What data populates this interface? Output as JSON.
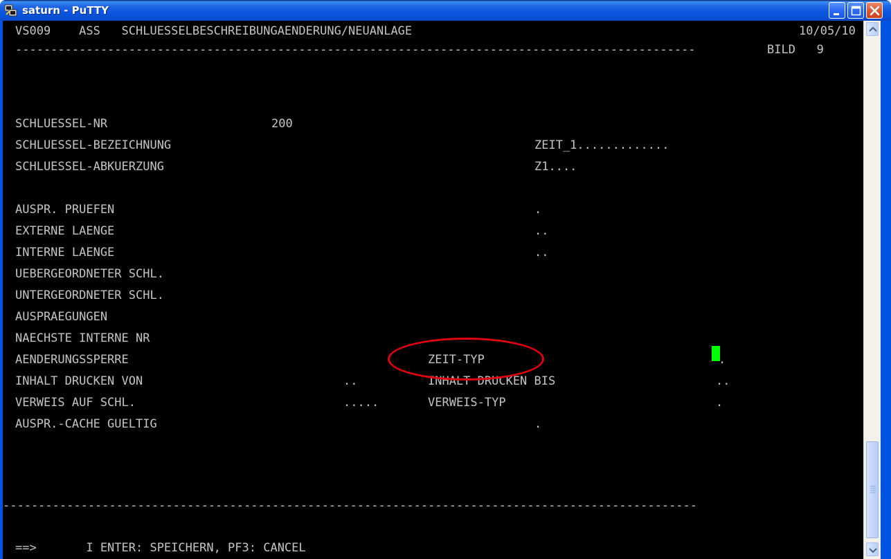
{
  "window": {
    "title": "saturn - PuTTY"
  },
  "terminal": {
    "lines": {
      "header": "VS009    ASS   SCHLUESSELBESCHREIBUNGAENDERUNG/NEUANLAGE",
      "date": "10/05/10",
      "separator1": "------------------------------------------------------------------------------------------------",
      "bild": "BILD   9",
      "schluessel_nr_label": "SCHLUESSEL-NR",
      "schluessel_nr_value": "200",
      "bezeichnung_label": "SCHLUESSEL-BEZEICHNUNG",
      "bezeichnung_value": "ZEIT_1.............",
      "abkuerzung_label": "SCHLUESSEL-ABKUERZUNG",
      "abkuerzung_value": "Z1....",
      "auspr_pruefen_label": "AUSPR. PRUEFEN",
      "auspr_pruefen_value": ".",
      "externe_laenge_label": "EXTERNE LAENGE",
      "externe_laenge_value": "..",
      "interne_laenge_label": "INTERNE LAENGE",
      "interne_laenge_value": "..",
      "uebergeordneter_label": "UEBERGEORDNETER SCHL.",
      "untergeordneter_label": "UNTERGEORDNETER SCHL.",
      "auspraegungen_label": "AUSPRAEGUNGEN",
      "naechste_label": "NAECHSTE INTERNE NR",
      "aenderungssperre_label": "AENDERUNGSSPERRE",
      "zeit_typ_label": "ZEIT-TYP",
      "zeit_typ_value": ".",
      "inhalt_von_label": "INHALT DRUCKEN VON",
      "inhalt_von_value": "..",
      "inhalt_bis_label": "INHALT DRUCKEN BIS",
      "inhalt_bis_value": "..",
      "verweis_label": "VERWEIS AUF SCHL.",
      "verweis_value": ".....",
      "verweis_typ_label": "VERWEIS-TYP",
      "verweis_typ_value": ".",
      "cache_label": "AUSPR.-CACHE GUELTIG",
      "cache_value": ".",
      "separator2": "--------------------------------------------------------------------------------------------------",
      "prompt": "==>       I ENTER: SPEICHERN, PF3: CANCEL"
    }
  },
  "colors": {
    "terminal_bg": "#000000",
    "terminal_fg": "#c4c4c4",
    "cursor": "#00ff00",
    "annotation": "#e0000e"
  }
}
